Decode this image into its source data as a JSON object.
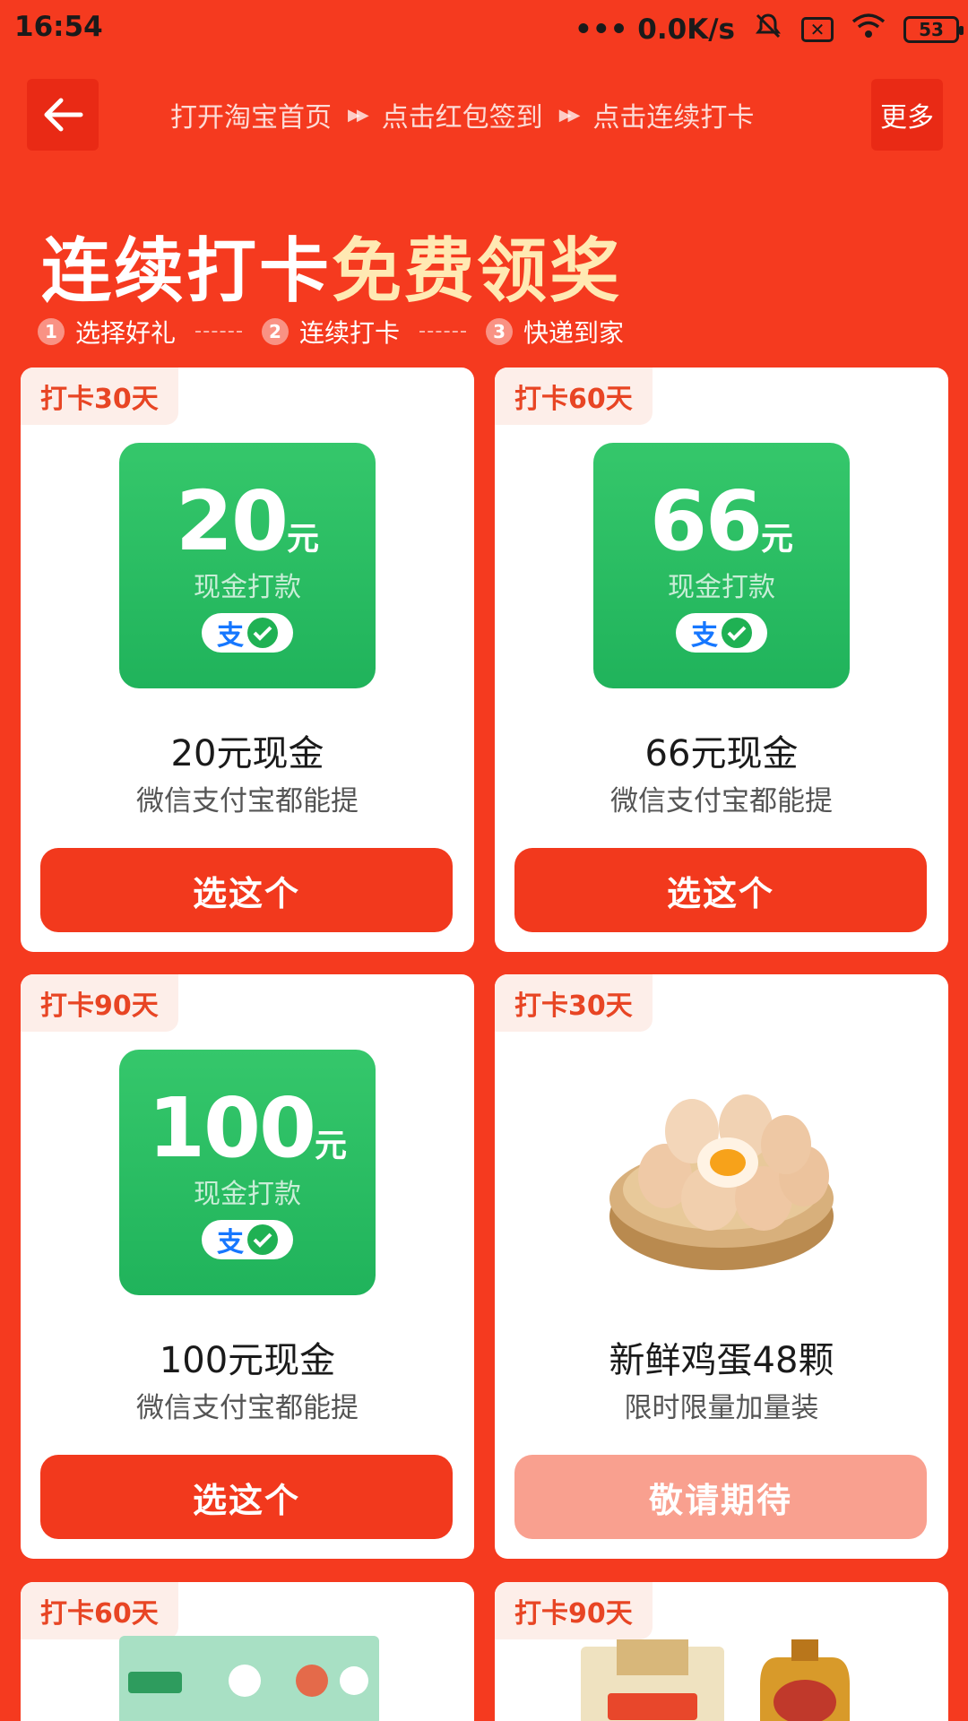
{
  "status_bar": {
    "time": "16:54",
    "network_speed": "••• 0.0K/s",
    "battery": "53"
  },
  "navbar": {
    "steps": [
      "打开淘宝首页",
      "点击红包签到",
      "点击连续打卡"
    ],
    "more_label": "更多"
  },
  "headline": {
    "part1": "连续打卡",
    "part2": "免费领奖"
  },
  "sub_steps": [
    {
      "num": "1",
      "label": "选择好礼"
    },
    {
      "num": "2",
      "label": "连续打卡"
    },
    {
      "num": "3",
      "label": "快递到家"
    }
  ],
  "cards": [
    {
      "tag": "打卡30天",
      "amount": "20",
      "unit": "元",
      "cash_label": "现金打款",
      "title": "20元现金",
      "desc": "微信支付宝都能提",
      "button": "选这个"
    },
    {
      "tag": "打卡60天",
      "amount": "66",
      "unit": "元",
      "cash_label": "现金打款",
      "title": "66元现金",
      "desc": "微信支付宝都能提",
      "button": "选这个"
    },
    {
      "tag": "打卡90天",
      "amount": "100",
      "unit": "元",
      "cash_label": "现金打款",
      "title": "100元现金",
      "desc": "微信支付宝都能提",
      "button": "选这个"
    },
    {
      "tag": "打卡30天",
      "title": "新鲜鸡蛋48颗",
      "desc": "限时限量加量装",
      "button": "敬请期待"
    },
    {
      "tag": "打卡60天"
    },
    {
      "tag": "打卡90天"
    }
  ],
  "pay_icons": {
    "alipay": "支",
    "wechat": "wechat-check-icon"
  },
  "colors": {
    "brand_red": "#f53a1f",
    "button_red": "#f2391d",
    "button_disabled": "#f9a08f",
    "cash_green": "#20b35b",
    "highlight_cream": "#ffe9b3"
  }
}
